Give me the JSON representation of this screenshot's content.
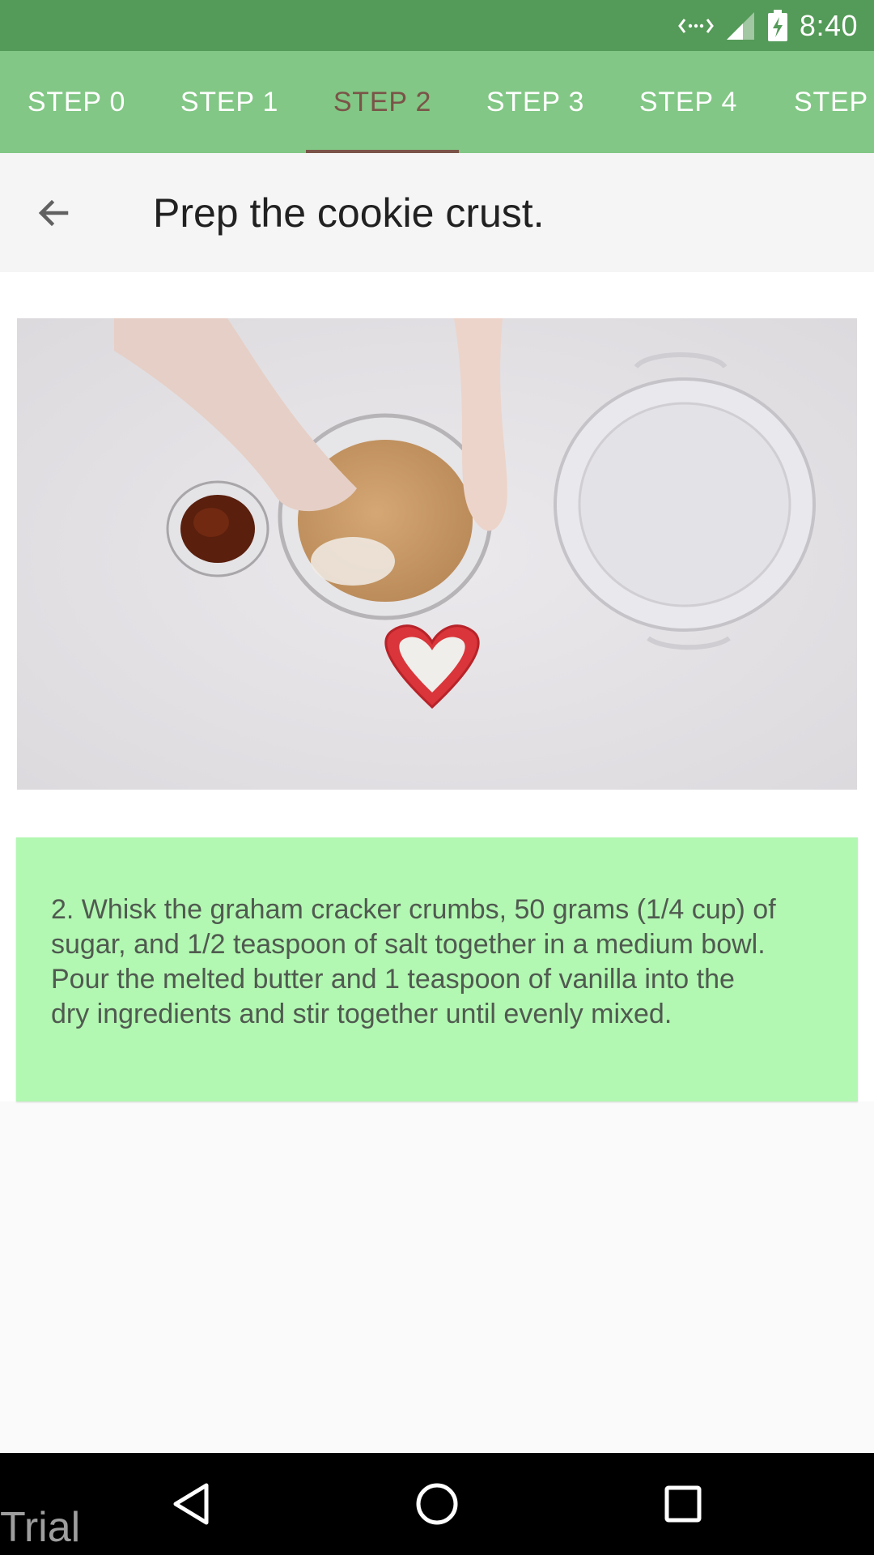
{
  "status_bar": {
    "time": "8:40",
    "icons": [
      "data-transfer-icon",
      "signal-icon",
      "battery-charging-icon"
    ]
  },
  "tabs": [
    {
      "label": "STEP 0",
      "active": false
    },
    {
      "label": "STEP 1",
      "active": false
    },
    {
      "label": "STEP 2",
      "active": true
    },
    {
      "label": "STEP 3",
      "active": false
    },
    {
      "label": "STEP 4",
      "active": false
    },
    {
      "label": "STEP",
      "active": false
    }
  ],
  "header": {
    "back_icon": "arrow-left-icon",
    "title": "Prep the cookie crust."
  },
  "media": {
    "type": "video-thumbnail"
  },
  "step": {
    "description": "2. Whisk the graham cracker crumbs, 50 grams (1/4 cup) of sugar, and 1/2 teaspoon of salt together in a medium bowl. Pour the melted butter and 1 teaspoon of vanilla into the dry ingredients and stir together until evenly mixed."
  },
  "nav_bar": {
    "watermark": "Trial",
    "buttons": [
      "back-triangle-icon",
      "home-circle-icon",
      "recents-square-icon"
    ]
  },
  "colors": {
    "status_bar": "#549a58",
    "tab_bar": "#82c785",
    "tab_active": "#7a5448",
    "description_card": "#b2f7b2"
  }
}
